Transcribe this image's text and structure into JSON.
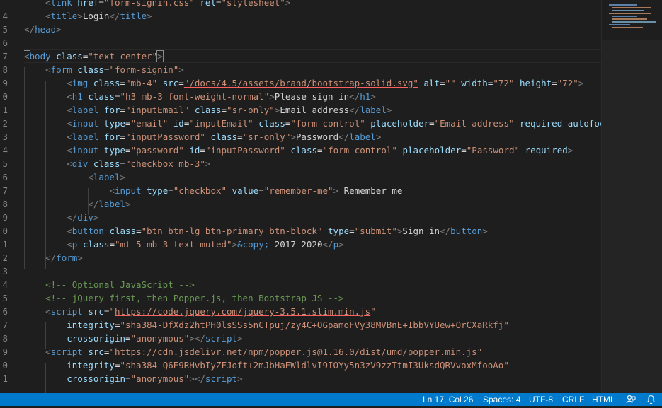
{
  "editor": {
    "line_numbers": [
      "",
      "4",
      "5",
      "6",
      "7",
      "8",
      "9",
      "0",
      "1",
      "2",
      "3",
      "4",
      "5",
      "6",
      "7",
      "8",
      "9",
      "0",
      "1",
      "2",
      "3",
      "4",
      "5",
      "6",
      "7",
      "8",
      "9",
      "0",
      "1"
    ],
    "lines": [
      [
        {
          "c": "t-x",
          "t": "    "
        },
        {
          "c": "t-p",
          "t": "<"
        },
        {
          "c": "t-t",
          "t": "link"
        },
        {
          "c": "t-x",
          "t": " "
        },
        {
          "c": "t-a",
          "t": "href"
        },
        {
          "c": "t-x",
          "t": "="
        },
        {
          "c": "t-s",
          "t": "\"form-signin.css\""
        },
        {
          "c": "t-x",
          "t": " "
        },
        {
          "c": "t-a",
          "t": "rel"
        },
        {
          "c": "t-x",
          "t": "="
        },
        {
          "c": "t-s",
          "t": "\"stylesheet\""
        },
        {
          "c": "t-p",
          "t": ">"
        }
      ],
      [
        {
          "c": "t-x",
          "t": "    "
        },
        {
          "c": "t-p",
          "t": "<"
        },
        {
          "c": "t-t",
          "t": "title"
        },
        {
          "c": "t-p",
          "t": ">"
        },
        {
          "c": "t-x",
          "t": "Login"
        },
        {
          "c": "t-p",
          "t": "</"
        },
        {
          "c": "t-t",
          "t": "title"
        },
        {
          "c": "t-p",
          "t": ">"
        }
      ],
      [
        {
          "c": "t-p",
          "t": "</"
        },
        {
          "c": "t-t",
          "t": "head"
        },
        {
          "c": "t-p",
          "t": ">"
        }
      ],
      [],
      [
        {
          "c": "t-p bracket",
          "t": "<"
        },
        {
          "c": "t-t",
          "t": "body"
        },
        {
          "c": "t-x",
          "t": " "
        },
        {
          "c": "t-a",
          "t": "class"
        },
        {
          "c": "t-x",
          "t": "="
        },
        {
          "c": "t-s",
          "t": "\"text-center\""
        },
        {
          "c": "t-p bracket",
          "t": ">"
        }
      ],
      [
        {
          "c": "t-x",
          "t": "    "
        },
        {
          "c": "t-p",
          "t": "<"
        },
        {
          "c": "t-t",
          "t": "form"
        },
        {
          "c": "t-x",
          "t": " "
        },
        {
          "c": "t-a",
          "t": "class"
        },
        {
          "c": "t-x",
          "t": "="
        },
        {
          "c": "t-s",
          "t": "\"form-signin\""
        },
        {
          "c": "t-p",
          "t": ">"
        }
      ],
      [
        {
          "c": "t-x",
          "t": "        "
        },
        {
          "c": "t-p",
          "t": "<"
        },
        {
          "c": "t-t",
          "t": "img"
        },
        {
          "c": "t-x",
          "t": " "
        },
        {
          "c": "t-a",
          "t": "class"
        },
        {
          "c": "t-x",
          "t": "="
        },
        {
          "c": "t-s",
          "t": "\"mb-4\""
        },
        {
          "c": "t-x",
          "t": " "
        },
        {
          "c": "t-a",
          "t": "src"
        },
        {
          "c": "t-x",
          "t": "="
        },
        {
          "c": "t-s ul-red",
          "t": "\"/docs/4.5/assets/brand/bootstrap-solid.svg\""
        },
        {
          "c": "t-x",
          "t": " "
        },
        {
          "c": "t-a",
          "t": "alt"
        },
        {
          "c": "t-x",
          "t": "="
        },
        {
          "c": "t-s",
          "t": "\"\""
        },
        {
          "c": "t-x",
          "t": " "
        },
        {
          "c": "t-a",
          "t": "width"
        },
        {
          "c": "t-x",
          "t": "="
        },
        {
          "c": "t-s",
          "t": "\"72\""
        },
        {
          "c": "t-x",
          "t": " "
        },
        {
          "c": "t-a",
          "t": "height"
        },
        {
          "c": "t-x",
          "t": "="
        },
        {
          "c": "t-s",
          "t": "\"72\""
        },
        {
          "c": "t-p",
          "t": ">"
        }
      ],
      [
        {
          "c": "t-x",
          "t": "        "
        },
        {
          "c": "t-p",
          "t": "<"
        },
        {
          "c": "t-t",
          "t": "h1"
        },
        {
          "c": "t-x",
          "t": " "
        },
        {
          "c": "t-a",
          "t": "class"
        },
        {
          "c": "t-x",
          "t": "="
        },
        {
          "c": "t-s",
          "t": "\"h3 mb-3 font-weight-normal\""
        },
        {
          "c": "t-p",
          "t": ">"
        },
        {
          "c": "t-x",
          "t": "Please sign in"
        },
        {
          "c": "t-p",
          "t": "</"
        },
        {
          "c": "t-t",
          "t": "h1"
        },
        {
          "c": "t-p",
          "t": ">"
        }
      ],
      [
        {
          "c": "t-x",
          "t": "        "
        },
        {
          "c": "t-p",
          "t": "<"
        },
        {
          "c": "t-t",
          "t": "label"
        },
        {
          "c": "t-x",
          "t": " "
        },
        {
          "c": "t-a",
          "t": "for"
        },
        {
          "c": "t-x",
          "t": "="
        },
        {
          "c": "t-s",
          "t": "\"inputEmail\""
        },
        {
          "c": "t-x",
          "t": " "
        },
        {
          "c": "t-a",
          "t": "class"
        },
        {
          "c": "t-x",
          "t": "="
        },
        {
          "c": "t-s",
          "t": "\"sr-only\""
        },
        {
          "c": "t-p",
          "t": ">"
        },
        {
          "c": "t-x",
          "t": "Email address"
        },
        {
          "c": "t-p",
          "t": "</"
        },
        {
          "c": "t-t",
          "t": "label"
        },
        {
          "c": "t-p",
          "t": ">"
        }
      ],
      [
        {
          "c": "t-x",
          "t": "        "
        },
        {
          "c": "t-p",
          "t": "<"
        },
        {
          "c": "t-t",
          "t": "input"
        },
        {
          "c": "t-x",
          "t": " "
        },
        {
          "c": "t-a",
          "t": "type"
        },
        {
          "c": "t-x",
          "t": "="
        },
        {
          "c": "t-s",
          "t": "\"email\""
        },
        {
          "c": "t-x",
          "t": " "
        },
        {
          "c": "t-a",
          "t": "id"
        },
        {
          "c": "t-x",
          "t": "="
        },
        {
          "c": "t-s",
          "t": "\"inputEmail\""
        },
        {
          "c": "t-x",
          "t": " "
        },
        {
          "c": "t-a",
          "t": "class"
        },
        {
          "c": "t-x",
          "t": "="
        },
        {
          "c": "t-s",
          "t": "\"form-control\""
        },
        {
          "c": "t-x",
          "t": " "
        },
        {
          "c": "t-a",
          "t": "placeholder"
        },
        {
          "c": "t-x",
          "t": "="
        },
        {
          "c": "t-s",
          "t": "\"Email address\""
        },
        {
          "c": "t-x",
          "t": " "
        },
        {
          "c": "t-a",
          "t": "required"
        },
        {
          "c": "t-x",
          "t": " "
        },
        {
          "c": "t-a",
          "t": "autofocus"
        },
        {
          "c": "t-p",
          "t": ">"
        }
      ],
      [
        {
          "c": "t-x",
          "t": "        "
        },
        {
          "c": "t-p",
          "t": "<"
        },
        {
          "c": "t-t",
          "t": "label"
        },
        {
          "c": "t-x",
          "t": " "
        },
        {
          "c": "t-a",
          "t": "for"
        },
        {
          "c": "t-x",
          "t": "="
        },
        {
          "c": "t-s",
          "t": "\"inputPassword\""
        },
        {
          "c": "t-x",
          "t": " "
        },
        {
          "c": "t-a",
          "t": "class"
        },
        {
          "c": "t-x",
          "t": "="
        },
        {
          "c": "t-s",
          "t": "\"sr-only\""
        },
        {
          "c": "t-p",
          "t": ">"
        },
        {
          "c": "t-x",
          "t": "Password"
        },
        {
          "c": "t-p",
          "t": "</"
        },
        {
          "c": "t-t",
          "t": "label"
        },
        {
          "c": "t-p",
          "t": ">"
        }
      ],
      [
        {
          "c": "t-x",
          "t": "        "
        },
        {
          "c": "t-p",
          "t": "<"
        },
        {
          "c": "t-t",
          "t": "input"
        },
        {
          "c": "t-x",
          "t": " "
        },
        {
          "c": "t-a",
          "t": "type"
        },
        {
          "c": "t-x",
          "t": "="
        },
        {
          "c": "t-s",
          "t": "\"password\""
        },
        {
          "c": "t-x",
          "t": " "
        },
        {
          "c": "t-a",
          "t": "id"
        },
        {
          "c": "t-x",
          "t": "="
        },
        {
          "c": "t-s",
          "t": "\"inputPassword\""
        },
        {
          "c": "t-x",
          "t": " "
        },
        {
          "c": "t-a",
          "t": "class"
        },
        {
          "c": "t-x",
          "t": "="
        },
        {
          "c": "t-s",
          "t": "\"form-control\""
        },
        {
          "c": "t-x",
          "t": " "
        },
        {
          "c": "t-a",
          "t": "placeholder"
        },
        {
          "c": "t-x",
          "t": "="
        },
        {
          "c": "t-s",
          "t": "\"Password\""
        },
        {
          "c": "t-x",
          "t": " "
        },
        {
          "c": "t-a",
          "t": "required"
        },
        {
          "c": "t-p",
          "t": ">"
        }
      ],
      [
        {
          "c": "t-x",
          "t": "        "
        },
        {
          "c": "t-p",
          "t": "<"
        },
        {
          "c": "t-t",
          "t": "div"
        },
        {
          "c": "t-x",
          "t": " "
        },
        {
          "c": "t-a",
          "t": "class"
        },
        {
          "c": "t-x",
          "t": "="
        },
        {
          "c": "t-s",
          "t": "\"checkbox mb-3\""
        },
        {
          "c": "t-p",
          "t": ">"
        }
      ],
      [
        {
          "c": "t-x",
          "t": "            "
        },
        {
          "c": "t-p",
          "t": "<"
        },
        {
          "c": "t-t",
          "t": "label"
        },
        {
          "c": "t-p",
          "t": ">"
        }
      ],
      [
        {
          "c": "t-x",
          "t": "                "
        },
        {
          "c": "t-p",
          "t": "<"
        },
        {
          "c": "t-t",
          "t": "input"
        },
        {
          "c": "t-x",
          "t": " "
        },
        {
          "c": "t-a",
          "t": "type"
        },
        {
          "c": "t-x",
          "t": "="
        },
        {
          "c": "t-s",
          "t": "\"checkbox\""
        },
        {
          "c": "t-x",
          "t": " "
        },
        {
          "c": "t-a",
          "t": "value"
        },
        {
          "c": "t-x",
          "t": "="
        },
        {
          "c": "t-s",
          "t": "\"remember-me\""
        },
        {
          "c": "t-p",
          "t": ">"
        },
        {
          "c": "t-x",
          "t": " Remember me"
        }
      ],
      [
        {
          "c": "t-x",
          "t": "            "
        },
        {
          "c": "t-p",
          "t": "</"
        },
        {
          "c": "t-t",
          "t": "label"
        },
        {
          "c": "t-p",
          "t": ">"
        }
      ],
      [
        {
          "c": "t-x",
          "t": "        "
        },
        {
          "c": "t-p",
          "t": "</"
        },
        {
          "c": "t-t",
          "t": "div"
        },
        {
          "c": "t-p",
          "t": ">"
        }
      ],
      [
        {
          "c": "t-x",
          "t": "        "
        },
        {
          "c": "t-p",
          "t": "<"
        },
        {
          "c": "t-t",
          "t": "button"
        },
        {
          "c": "t-x",
          "t": " "
        },
        {
          "c": "t-a",
          "t": "class"
        },
        {
          "c": "t-x",
          "t": "="
        },
        {
          "c": "t-s",
          "t": "\"btn btn-lg btn-primary btn-block\""
        },
        {
          "c": "t-x",
          "t": " "
        },
        {
          "c": "t-a",
          "t": "type"
        },
        {
          "c": "t-x",
          "t": "="
        },
        {
          "c": "t-s",
          "t": "\"submit\""
        },
        {
          "c": "t-p",
          "t": ">"
        },
        {
          "c": "t-x",
          "t": "Sign in"
        },
        {
          "c": "t-p",
          "t": "</"
        },
        {
          "c": "t-t",
          "t": "button"
        },
        {
          "c": "t-p",
          "t": ">"
        }
      ],
      [
        {
          "c": "t-x",
          "t": "        "
        },
        {
          "c": "t-p",
          "t": "<"
        },
        {
          "c": "t-t",
          "t": "p"
        },
        {
          "c": "t-x",
          "t": " "
        },
        {
          "c": "t-a",
          "t": "class"
        },
        {
          "c": "t-x",
          "t": "="
        },
        {
          "c": "t-s",
          "t": "\"mt-5 mb-3 text-muted\""
        },
        {
          "c": "t-p",
          "t": ">"
        },
        {
          "c": "t-e",
          "t": "&copy;"
        },
        {
          "c": "t-x",
          "t": " 2017-2020"
        },
        {
          "c": "t-p",
          "t": "</"
        },
        {
          "c": "t-t",
          "t": "p"
        },
        {
          "c": "t-p",
          "t": ">"
        }
      ],
      [
        {
          "c": "t-x",
          "t": "    "
        },
        {
          "c": "t-p",
          "t": "</"
        },
        {
          "c": "t-t",
          "t": "form"
        },
        {
          "c": "t-p",
          "t": ">"
        }
      ],
      [],
      [
        {
          "c": "t-x",
          "t": "    "
        },
        {
          "c": "t-c",
          "t": "<!-- Optional JavaScript -->"
        }
      ],
      [
        {
          "c": "t-x",
          "t": "    "
        },
        {
          "c": "t-c",
          "t": "<!-- jQuery first, then Popper.js, then Bootstrap JS -->"
        }
      ],
      [
        {
          "c": "t-x",
          "t": "    "
        },
        {
          "c": "t-p",
          "t": "<"
        },
        {
          "c": "t-t",
          "t": "script"
        },
        {
          "c": "t-x",
          "t": " "
        },
        {
          "c": "t-a",
          "t": "src"
        },
        {
          "c": "t-x",
          "t": "="
        },
        {
          "c": "t-s",
          "t": "\""
        },
        {
          "c": "t-s ul-red",
          "t": "https://code.jquery.com/jquery-3.5.1.slim.min.js"
        },
        {
          "c": "t-s",
          "t": "\""
        }
      ],
      [
        {
          "c": "t-x",
          "t": "        "
        },
        {
          "c": "t-a",
          "t": "integrity"
        },
        {
          "c": "t-x",
          "t": "="
        },
        {
          "c": "t-s",
          "t": "\"sha384-DfXdz2htPH0lsSSs5nCTpuj/zy4C+OGpamoFVy38MVBnE+IbbVYUew+OrCXaRkfj\""
        }
      ],
      [
        {
          "c": "t-x",
          "t": "        "
        },
        {
          "c": "t-a",
          "t": "crossorigin"
        },
        {
          "c": "t-x",
          "t": "="
        },
        {
          "c": "t-s",
          "t": "\"anonymous\""
        },
        {
          "c": "t-p",
          "t": "></"
        },
        {
          "c": "t-t",
          "t": "script"
        },
        {
          "c": "t-p",
          "t": ">"
        }
      ],
      [
        {
          "c": "t-x",
          "t": "    "
        },
        {
          "c": "t-p",
          "t": "<"
        },
        {
          "c": "t-t",
          "t": "script"
        },
        {
          "c": "t-x",
          "t": " "
        },
        {
          "c": "t-a",
          "t": "src"
        },
        {
          "c": "t-x",
          "t": "="
        },
        {
          "c": "t-s",
          "t": "\""
        },
        {
          "c": "t-s ul-red",
          "t": "https://cdn.jsdelivr.net/npm/popper.js@1.16.0/dist/umd/popper.min.js"
        },
        {
          "c": "t-s",
          "t": "\""
        }
      ],
      [
        {
          "c": "t-x",
          "t": "        "
        },
        {
          "c": "t-a",
          "t": "integrity"
        },
        {
          "c": "t-x",
          "t": "="
        },
        {
          "c": "t-s",
          "t": "\"sha384-Q6E9RHvbIyZFJoft+2mJbHaEWldlvI9IOYy5n3zV9zzTtmI3UksdQRVvoxMfooAo\""
        }
      ],
      [
        {
          "c": "t-x",
          "t": "        "
        },
        {
          "c": "t-a",
          "t": "crossorigin"
        },
        {
          "c": "t-x",
          "t": "="
        },
        {
          "c": "t-s",
          "t": "\"anonymous\""
        },
        {
          "c": "t-p",
          "t": "></"
        },
        {
          "c": "t-t",
          "t": "script"
        },
        {
          "c": "t-p",
          "t": ">"
        }
      ]
    ]
  },
  "status_bar": {
    "position": "Ln 17, Col 26",
    "spaces": "Spaces: 4",
    "encoding": "UTF-8",
    "eol": "CRLF",
    "language": "HTML",
    "feedback_icon": "person-feedback-icon",
    "bell_icon": "bell-icon"
  },
  "colors": {
    "background": "#1e1e1e",
    "status_bar": "#007acc",
    "tag": "#569cd6",
    "attribute": "#9cdcfe",
    "string": "#ce9178",
    "comment": "#6a9955"
  }
}
